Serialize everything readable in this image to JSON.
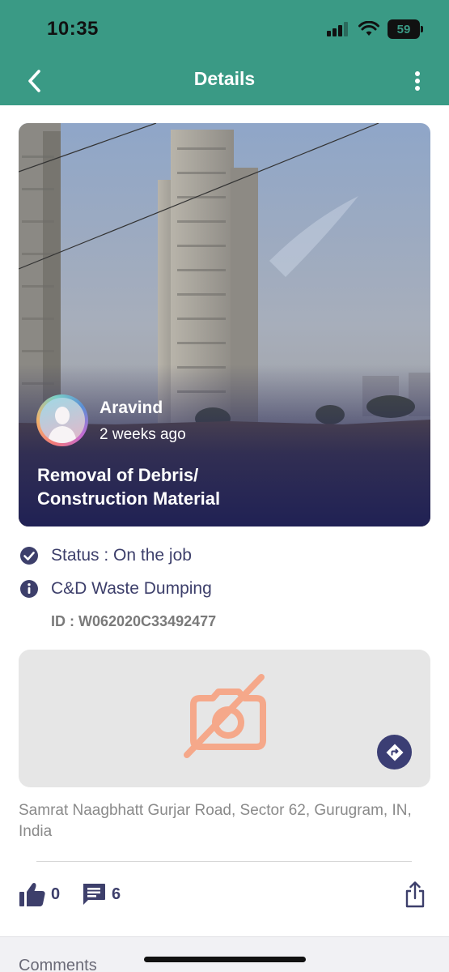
{
  "status_bar": {
    "time": "10:35",
    "battery": "59"
  },
  "header": {
    "title": "Details"
  },
  "post": {
    "author": "Aravind",
    "time_ago": "2 weeks ago",
    "title": "Removal of Debris/\nConstruction Material"
  },
  "details": {
    "status": "Status : On the job",
    "category": "C&D Waste Dumping",
    "id": "ID : W062020C33492477"
  },
  "location": {
    "address": "Samrat Naagbhatt Gurjar Road, Sector 62, Gurugram, IN, India"
  },
  "actions": {
    "likes": "0",
    "comments": "6"
  },
  "comments_section": {
    "label": "Comments"
  },
  "colors": {
    "header": "#3a9a85",
    "accent": "#3d3f6b",
    "placeholder_icon": "#f5a88a"
  },
  "icons": [
    "back-arrow-icon",
    "more-vertical-icon",
    "check-circle-icon",
    "info-circle-icon",
    "no-camera-icon",
    "directions-icon",
    "thumbs-up-icon",
    "comment-icon",
    "share-icon"
  ]
}
